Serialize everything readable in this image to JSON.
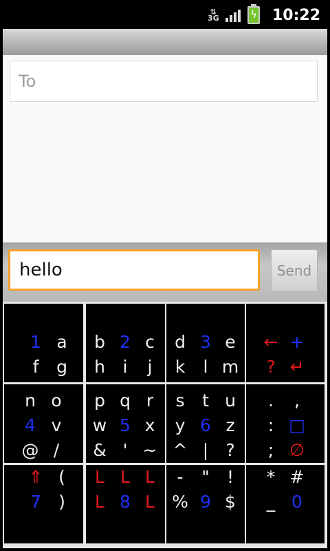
{
  "status_bar": {
    "network": "3G",
    "time": "10:22"
  },
  "compose": {
    "to_placeholder": "To",
    "message_text": "hello",
    "send_label": "Send"
  },
  "keyboard": {
    "keys": [
      {
        "row": 0,
        "col": 0,
        "labels": [
          {
            "text": "1",
            "color": "blue"
          },
          {
            "text": "a",
            "color": "white"
          },
          {
            "text": "f",
            "color": "white"
          },
          {
            "text": "g",
            "color": "white"
          }
        ]
      },
      {
        "row": 0,
        "col": 1,
        "labels": [
          {
            "text": "b",
            "color": "white"
          },
          {
            "text": "2",
            "color": "blue"
          },
          {
            "text": "c",
            "color": "white"
          },
          {
            "text": "h",
            "color": "white"
          },
          {
            "text": "i",
            "color": "white"
          },
          {
            "text": "j",
            "color": "white"
          }
        ]
      },
      {
        "row": 0,
        "col": 2,
        "labels": [
          {
            "text": "d",
            "color": "white"
          },
          {
            "text": "3",
            "color": "blue"
          },
          {
            "text": "e",
            "color": "white"
          },
          {
            "text": "k",
            "color": "white"
          },
          {
            "text": "l",
            "color": "white"
          },
          {
            "text": "m",
            "color": "white"
          }
        ]
      },
      {
        "row": 0,
        "col": 3,
        "labels": [
          {
            "text": "←",
            "color": "red"
          },
          {
            "text": "+",
            "color": "blue"
          },
          {
            "text": "?",
            "color": "red"
          },
          {
            "text": "↵",
            "color": "red"
          }
        ]
      },
      {
        "row": 1,
        "col": 0,
        "labels": [
          {
            "text": "n",
            "color": "white"
          },
          {
            "text": "o",
            "color": "white"
          },
          {
            "text": "4",
            "color": "blue"
          },
          {
            "text": "v",
            "color": "white"
          },
          {
            "text": "@",
            "color": "white"
          },
          {
            "text": "/",
            "color": "white"
          }
        ]
      },
      {
        "row": 1,
        "col": 1,
        "labels": [
          {
            "text": "p",
            "color": "white"
          },
          {
            "text": "q",
            "color": "white"
          },
          {
            "text": "r",
            "color": "white"
          },
          {
            "text": "w",
            "color": "white"
          },
          {
            "text": "5",
            "color": "blue"
          },
          {
            "text": "x",
            "color": "white"
          },
          {
            "text": "&",
            "color": "white"
          },
          {
            "text": "'",
            "color": "white"
          },
          {
            "text": "~",
            "color": "white"
          }
        ]
      },
      {
        "row": 1,
        "col": 2,
        "labels": [
          {
            "text": "s",
            "color": "white"
          },
          {
            "text": "t",
            "color": "white"
          },
          {
            "text": "u",
            "color": "white"
          },
          {
            "text": "y",
            "color": "white"
          },
          {
            "text": "6",
            "color": "blue"
          },
          {
            "text": "z",
            "color": "white"
          },
          {
            "text": "^",
            "color": "white"
          },
          {
            "text": "|",
            "color": "white"
          },
          {
            "text": "?",
            "color": "white"
          }
        ]
      },
      {
        "row": 1,
        "col": 3,
        "labels": [
          {
            "text": ".",
            "color": "white"
          },
          {
            "text": ",",
            "color": "white"
          },
          {
            "text": ":",
            "color": "white"
          },
          {
            "text": "□",
            "color": "blue"
          },
          {
            "text": ";",
            "color": "white"
          },
          {
            "text": "∅",
            "color": "red"
          }
        ]
      },
      {
        "row": 2,
        "col": 0,
        "labels": [
          {
            "text": "⇑",
            "color": "red"
          },
          {
            "text": "(",
            "color": "white"
          },
          {
            "text": "7",
            "color": "blue"
          },
          {
            "text": ")",
            "color": "white"
          }
        ]
      },
      {
        "row": 2,
        "col": 1,
        "labels": [
          {
            "text": "L",
            "color": "red"
          },
          {
            "text": "L",
            "color": "red"
          },
          {
            "text": "L",
            "color": "red"
          },
          {
            "text": "L",
            "color": "red"
          },
          {
            "text": "8",
            "color": "blue"
          },
          {
            "text": "L",
            "color": "red"
          }
        ]
      },
      {
        "row": 2,
        "col": 2,
        "labels": [
          {
            "text": "-",
            "color": "white"
          },
          {
            "text": "\"",
            "color": "white"
          },
          {
            "text": "!",
            "color": "white"
          },
          {
            "text": "%",
            "color": "white"
          },
          {
            "text": "9",
            "color": "blue"
          },
          {
            "text": "$",
            "color": "white"
          }
        ]
      },
      {
        "row": 2,
        "col": 3,
        "labels": [
          {
            "text": "*",
            "color": "white"
          },
          {
            "text": "#",
            "color": "white"
          },
          {
            "text": "_",
            "color": "white"
          },
          {
            "text": "0",
            "color": "blue"
          }
        ]
      }
    ]
  }
}
